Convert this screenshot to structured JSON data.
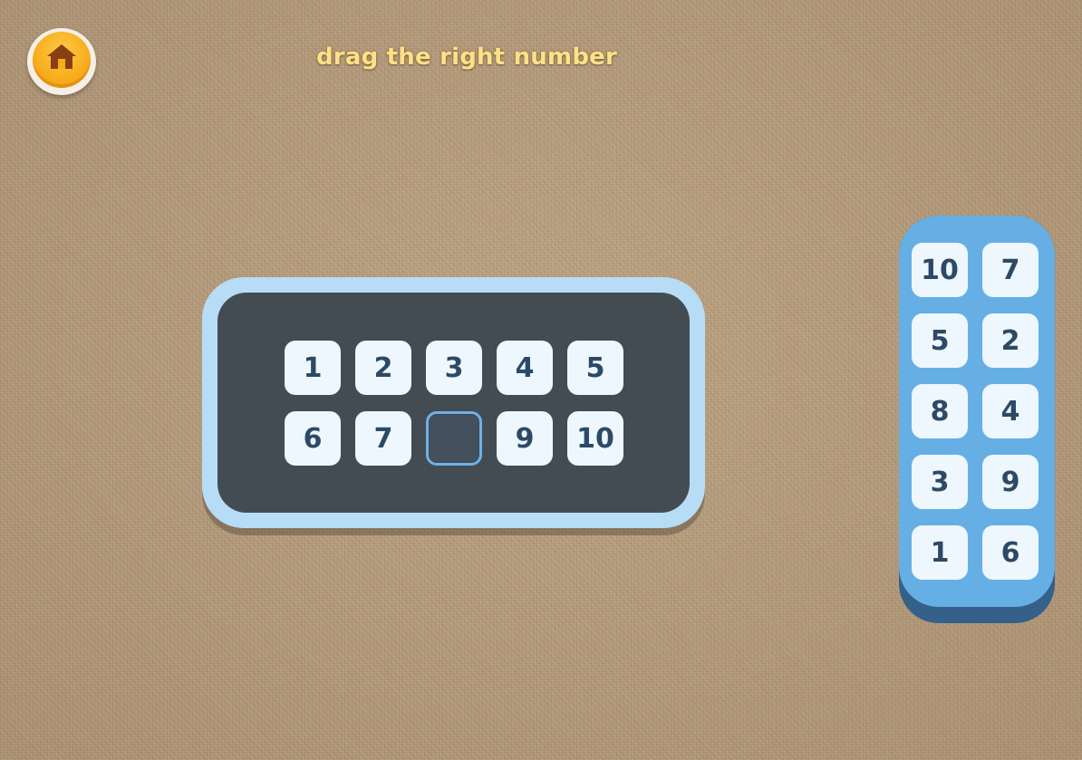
{
  "header": {
    "home_icon": "home-icon",
    "title": "drag the right number"
  },
  "board": {
    "tiles": [
      "1",
      "2",
      "3",
      "4",
      "5",
      "6",
      "7",
      "",
      "9",
      "10"
    ],
    "empty_slot_index": 7
  },
  "tray": {
    "tiles": [
      "10",
      "7",
      "5",
      "2",
      "8",
      "4",
      "3",
      "9",
      "1",
      "6"
    ]
  },
  "colors": {
    "board_frame": "#b7dcf5",
    "board_inner": "#3a3f44",
    "tray": "#66afe4",
    "tile_bg": "#eef7fd",
    "tile_text": "#2c4a66",
    "title_text": "#ffe08a",
    "home_button": "#f7ad1b"
  }
}
